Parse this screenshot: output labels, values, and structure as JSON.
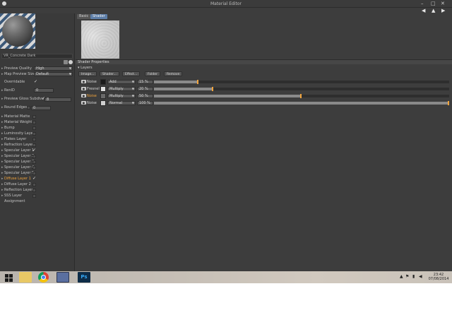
{
  "window": {
    "title": "Material Editor"
  },
  "window_controls": {
    "minimize": "–",
    "maximize": "□",
    "close": "✕"
  },
  "nav": {
    "back": "◀",
    "up": "▲",
    "forward": "▶"
  },
  "left_panel": {
    "material_name": "VR_Concrete Dark",
    "settings": [
      {
        "label": "Preview Quality",
        "value": "High"
      },
      {
        "label": "Map Preview Size",
        "value": "Default"
      },
      {
        "label": "Overridable",
        "checked": true
      },
      {
        "label": "RenID",
        "value": "0"
      },
      {
        "label": "Preview Gloss Subdivs",
        "value": "8",
        "checked": true
      },
      {
        "label": "Round Edges",
        "value": "0"
      }
    ],
    "channels": [
      {
        "label": "Material Matte",
        "checked": false
      },
      {
        "label": "Material Weight",
        "checked": false
      },
      {
        "label": "Bump",
        "checked": false
      },
      {
        "label": "Luminosity Layer",
        "checked": false
      },
      {
        "label": "Flakes Layer",
        "checked": false
      },
      {
        "label": "Refraction Layer",
        "checked": false
      },
      {
        "label": "Specular Layer 1",
        "checked": true
      },
      {
        "label": "Specular Layer 2",
        "checked": false
      },
      {
        "label": "Specular Layer 3",
        "checked": false
      },
      {
        "label": "Specular Layer 4",
        "checked": false
      },
      {
        "label": "Specular Layer 5",
        "checked": false
      },
      {
        "label": "Diffuse Layer 1",
        "checked": true,
        "active": true
      },
      {
        "label": "Diffuse Layer 2",
        "checked": false
      },
      {
        "label": "Reflection Layer",
        "checked": false
      },
      {
        "label": "SSS Layer",
        "checked": false
      },
      {
        "label": "Assignment"
      }
    ]
  },
  "main": {
    "tabs": [
      {
        "label": "Basic"
      },
      {
        "label": "Shader"
      }
    ],
    "shader_properties": "Shader Properties",
    "layers_header": "Layers",
    "actions": [
      "Image...",
      "Shader...",
      "Effect...",
      "Folder",
      "Remove"
    ],
    "layers": [
      {
        "name": "Noise",
        "mode": "Add",
        "percent": "15 %",
        "level": 15,
        "thumb": "#1a1a1a",
        "active": false
      },
      {
        "name": "Fresnel",
        "mode": "Multiply",
        "percent": "20 %",
        "level": 20,
        "thumb": "#e0e0e0",
        "active": false
      },
      {
        "name": "Noise",
        "mode": "Multiply",
        "percent": "50 %",
        "level": 50,
        "thumb": "#6a6a6a",
        "active": true
      },
      {
        "name": "Noise",
        "mode": "Normal",
        "percent": "100 %",
        "level": 100,
        "thumb": "#cfcfcf",
        "active": false
      }
    ]
  },
  "taskbar": {
    "apps": [
      "start",
      "file-explorer",
      "chrome",
      "cinema4d",
      "photoshop"
    ],
    "ps_label": "Ps",
    "clock_time": "23:42",
    "clock_date": "07/08/2014"
  },
  "colors": {
    "accent": "#f0a33c",
    "tab_selected": "#5d7ea8",
    "panel": "#3d3d3d"
  }
}
